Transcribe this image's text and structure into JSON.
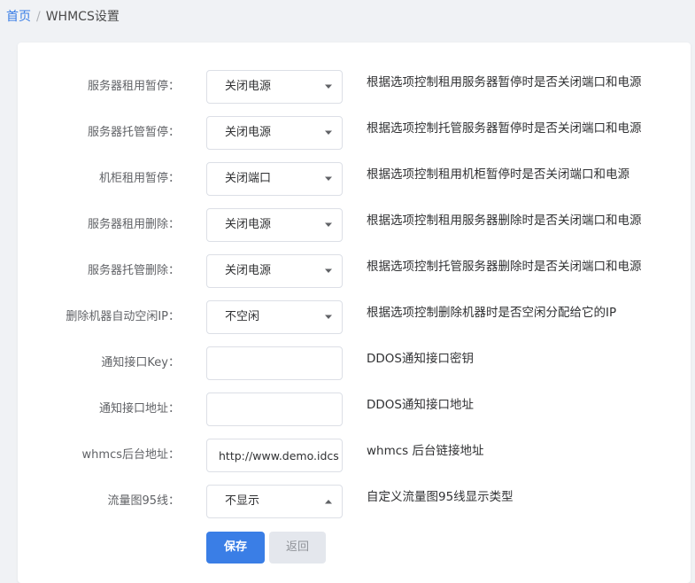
{
  "breadcrumb": {
    "home": "首页",
    "separator": "/",
    "current": "WHMCS设置"
  },
  "form": {
    "rows": [
      {
        "label": "服务器租用暂停：",
        "type": "select",
        "value": "关闭电源",
        "caret": "down",
        "help": "根据选项控制租用服务器暂停时是否关闭端口和电源"
      },
      {
        "label": "服务器托管暂停：",
        "type": "select",
        "value": "关闭电源",
        "caret": "down",
        "help": "根据选项控制托管服务器暂停时是否关闭端口和电源"
      },
      {
        "label": "机柜租用暂停：",
        "type": "select",
        "value": "关闭端口",
        "caret": "down",
        "help": "根据选项控制租用机柜暂停时是否关闭端口和电源"
      },
      {
        "label": "服务器租用删除：",
        "type": "select",
        "value": "关闭电源",
        "caret": "down",
        "help": "根据选项控制租用服务器删除时是否关闭端口和电源"
      },
      {
        "label": "服务器托管删除：",
        "type": "select",
        "value": "关闭电源",
        "caret": "down",
        "help": "根据选项控制托管服务器删除时是否关闭端口和电源"
      },
      {
        "label": "删除机器自动空闲IP：",
        "type": "select",
        "value": "不空闲",
        "caret": "down",
        "help": "根据选项控制删除机器时是否空闲分配给它的IP"
      },
      {
        "label": "通知接口Key：",
        "type": "input",
        "value": "",
        "help": "DDOS通知接口密钥"
      },
      {
        "label": "通知接口地址：",
        "type": "input",
        "value": "",
        "help": "DDOS通知接口地址"
      },
      {
        "label": "whmcs后台地址：",
        "type": "input",
        "value": "http://www.demo.idcsmart.com",
        "help": "whmcs 后台链接地址"
      },
      {
        "label": "流量图95线：",
        "type": "select",
        "value": "不显示",
        "caret": "up",
        "help": "自定义流量图95线显示类型"
      }
    ],
    "save_label": "保存",
    "back_label": "返回"
  },
  "colors": {
    "primary": "#3a7ee6",
    "background": "#f0f2f5",
    "border": "#dcdfe6"
  }
}
